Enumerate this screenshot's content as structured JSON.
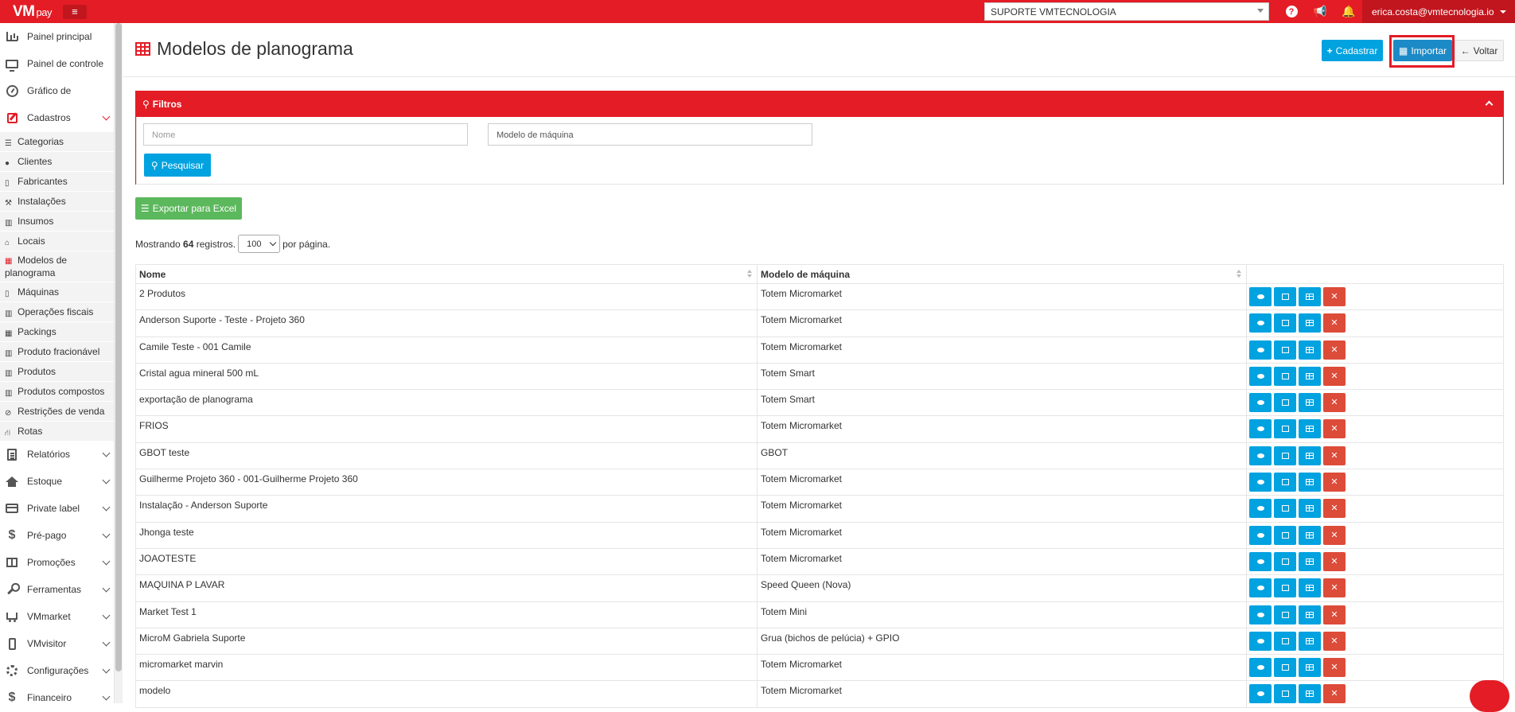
{
  "topbar": {
    "logo": "VM",
    "logo_suffix": "pay",
    "client_select": "SUPORTE VMTECNOLOGIA",
    "user_email": "erica.costa@vmtecnologia.io"
  },
  "sidebar": {
    "items_top": [
      {
        "label": "Painel principal",
        "icon": "bar-chart-icon"
      },
      {
        "label": "Painel de controle",
        "icon": "monitor-icon"
      },
      {
        "label": "Gráfico de",
        "icon": "dashboard-icon"
      },
      {
        "label": "Cadastros",
        "icon": "edit-icon",
        "expanded": true
      }
    ],
    "sub_items": [
      {
        "label": "Categorias",
        "icon": "list-icon"
      },
      {
        "label": "Clientes",
        "icon": "users-icon"
      },
      {
        "label": "Fabricantes",
        "icon": "file-icon"
      },
      {
        "label": "Instalações",
        "icon": "wrench-icon"
      },
      {
        "label": "Insumos",
        "icon": "barcode-icon"
      },
      {
        "label": "Locais",
        "icon": "home-icon"
      },
      {
        "label": "Modelos de planograma",
        "icon": "table-icon",
        "current": true
      },
      {
        "label": "Máquinas",
        "icon": "mobile-icon"
      },
      {
        "label": "Operações fiscais",
        "icon": "barcode-icon"
      },
      {
        "label": "Packings",
        "icon": "th-icon"
      },
      {
        "label": "Produto fracionável",
        "icon": "barcode-icon"
      },
      {
        "label": "Produtos",
        "icon": "barcode-icon"
      },
      {
        "label": "Produtos compostos",
        "icon": "barcode-icon"
      },
      {
        "label": "Restrições de venda",
        "icon": "ban-icon"
      },
      {
        "label": "Rotas",
        "icon": "road-icon"
      }
    ],
    "items_bottom": [
      {
        "label": "Relatórios",
        "icon": "document-icon"
      },
      {
        "label": "Estoque",
        "icon": "home-icon"
      },
      {
        "label": "Private label",
        "icon": "credit-card-icon"
      },
      {
        "label": "Pré-pago",
        "icon": "dollar-icon"
      },
      {
        "label": "Promoções",
        "icon": "gift-icon"
      },
      {
        "label": "Ferramentas",
        "icon": "wrench-icon"
      },
      {
        "label": "VMmarket",
        "icon": "cart-icon"
      },
      {
        "label": "VMvisitor",
        "icon": "mobile-icon"
      },
      {
        "label": "Configurações",
        "icon": "cogs-icon"
      },
      {
        "label": "Financeiro",
        "icon": "dollar-icon"
      }
    ]
  },
  "page": {
    "title": "Modelos de planograma",
    "cadastrar_label": "Cadastrar",
    "importar_label": "Importar",
    "voltar_label": "Voltar"
  },
  "filters": {
    "title": "Filtros",
    "nome_placeholder": "Nome",
    "modelo_placeholder": "Modelo de máquina",
    "search_label": "Pesquisar"
  },
  "export_label": "Exportar para Excel",
  "pagination": {
    "showing_prefix": "Mostrando",
    "count": "64",
    "registros": "registros.",
    "per_page_value": "100",
    "per_page_suffix": "por página."
  },
  "table": {
    "headers": [
      "Nome",
      "Modelo de máquina",
      ""
    ],
    "rows": [
      [
        "2 Produtos",
        "Totem Micromarket"
      ],
      [
        "Anderson Suporte - Teste - Projeto 360",
        "Totem Micromarket"
      ],
      [
        "Camile Teste - 001 Camile",
        "Totem Micromarket"
      ],
      [
        "Cristal agua mineral 500 mL",
        "Totem Smart"
      ],
      [
        "exportação de planograma",
        "Totem Smart"
      ],
      [
        "FRIOS",
        "Totem Micromarket"
      ],
      [
        "GBOT teste",
        "GBOT"
      ],
      [
        "Guilherme Projeto 360 - 001-Guilherme Projeto 360",
        "Totem Micromarket"
      ],
      [
        "Instalação - Anderson Suporte",
        "Totem Micromarket"
      ],
      [
        "Jhonga teste",
        "Totem Micromarket"
      ],
      [
        "JOAOTESTE",
        "Totem Micromarket"
      ],
      [
        "MAQUINA P LAVAR",
        "Speed Queen (Nova)"
      ],
      [
        "Market Test 1",
        "Totem Mini"
      ],
      [
        "MicroM Gabriela Suporte",
        "Grua (bichos de pelúcia) + GPIO"
      ],
      [
        "micromarket marvin",
        "Totem Micromarket"
      ],
      [
        "modelo",
        "Totem Micromarket"
      ]
    ]
  }
}
